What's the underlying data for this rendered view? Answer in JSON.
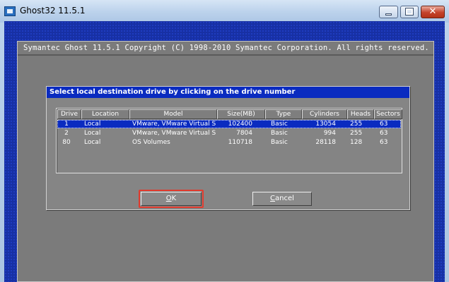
{
  "window": {
    "title": "Ghost32 11.5.1",
    "close_glyph": "✕"
  },
  "ghost": {
    "header": "Symantec Ghost 11.5.1   Copyright (C) 1998-2010 Symantec Corporation. All rights reserved."
  },
  "dialog": {
    "title": "Select local destination drive by clicking on the drive number",
    "columns": [
      "Drive",
      "Location",
      "Model",
      "Size(MB)",
      "Type",
      "Cylinders",
      "Heads",
      "Sectors"
    ],
    "rows": [
      {
        "drive": "1",
        "location": "Local",
        "model": "VMware, VMware Virtual S",
        "size": "102400",
        "type": "Basic",
        "cylinders": "13054",
        "heads": "255",
        "sectors": "63",
        "selected": true
      },
      {
        "drive": "2",
        "location": "Local",
        "model": "VMware, VMware Virtual S",
        "size": "7804",
        "type": "Basic",
        "cylinders": "994",
        "heads": "255",
        "sectors": "63",
        "selected": false
      },
      {
        "drive": "80",
        "location": "Local",
        "model": "OS Volumes",
        "size": "110718",
        "type": "Basic",
        "cylinders": "28118",
        "heads": "128",
        "sectors": "63",
        "selected": false
      }
    ],
    "ok_label_underlined": "O",
    "ok_label_rest": "K",
    "cancel_label_underlined": "C",
    "cancel_label_rest": "ancel"
  },
  "colors": {
    "dos_blue": "#1730a4",
    "selection_blue": "#0a2bc0",
    "highlight_red": "#e23b2e"
  }
}
